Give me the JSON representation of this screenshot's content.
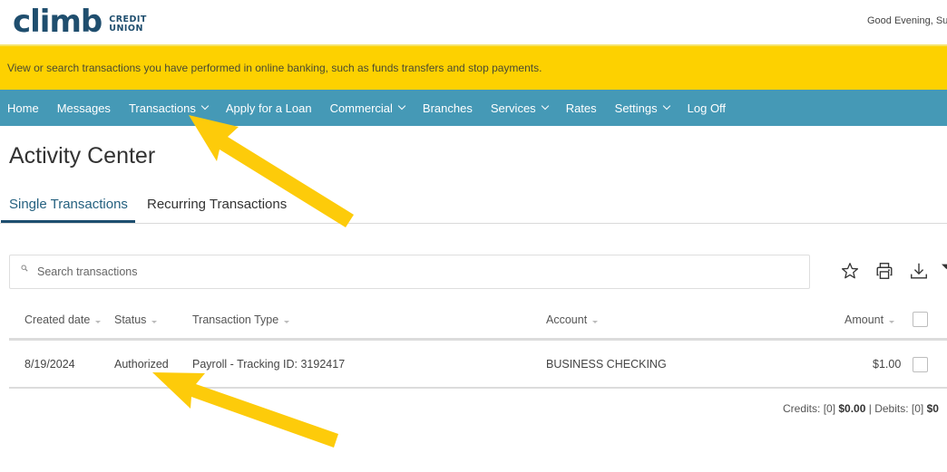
{
  "header": {
    "logo": {
      "word": "climb",
      "sub_line1": "CREDIT",
      "sub_line2": "UNION"
    },
    "greeting": "Good Evening, Sus"
  },
  "banner": {
    "text": "View or search transactions you have performed in online banking, such as funds transfers and stop payments."
  },
  "nav": {
    "items": [
      {
        "label": "Home",
        "dropdown": false
      },
      {
        "label": "Messages",
        "dropdown": false
      },
      {
        "label": "Transactions",
        "dropdown": true
      },
      {
        "label": "Apply for a Loan",
        "dropdown": false
      },
      {
        "label": "Commercial",
        "dropdown": true
      },
      {
        "label": "Branches",
        "dropdown": false
      },
      {
        "label": "Services",
        "dropdown": true
      },
      {
        "label": "Rates",
        "dropdown": false
      },
      {
        "label": "Settings",
        "dropdown": true
      },
      {
        "label": "Log Off",
        "dropdown": false
      }
    ]
  },
  "page": {
    "title": "Activity Center",
    "tabs": [
      {
        "label": "Single Transactions",
        "active": true
      },
      {
        "label": "Recurring Transactions",
        "active": false
      }
    ]
  },
  "search": {
    "placeholder": "Search transactions",
    "value": ""
  },
  "toolbar": {
    "icons": [
      "star-icon",
      "print-icon",
      "download-icon",
      "filter-icon"
    ]
  },
  "table": {
    "columns": [
      {
        "label": "Created date"
      },
      {
        "label": "Status"
      },
      {
        "label": "Transaction Type"
      },
      {
        "label": "Account"
      },
      {
        "label": "Amount"
      }
    ],
    "rows": [
      {
        "created_date": "8/19/2024",
        "status": "Authorized",
        "transaction_type": "Payroll - Tracking ID: 3192417",
        "account": "BUSINESS CHECKING",
        "amount": "$1.00",
        "checked": false
      }
    ]
  },
  "totals": {
    "credits_label": "Credits:",
    "credits_count": "[0]",
    "credits_amount": "$0.00",
    "separator": "|",
    "debits_label": "Debits:",
    "debits_count": "[0]",
    "debits_amount": "$0"
  },
  "colors": {
    "brand_navy": "#1f4e6e",
    "banner_yellow": "#fdd100",
    "nav_teal": "#4599b6",
    "annotation_arrow": "#fdcb0a"
  }
}
